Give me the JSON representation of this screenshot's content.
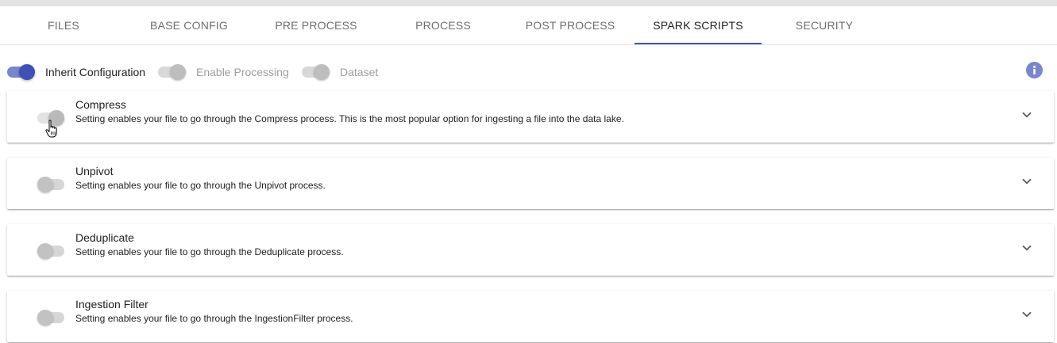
{
  "tabs": [
    {
      "label": "FILES",
      "active": false
    },
    {
      "label": "BASE CONFIG",
      "active": false
    },
    {
      "label": "PRE PROCESS",
      "active": false
    },
    {
      "label": "PROCESS",
      "active": false
    },
    {
      "label": "POST PROCESS",
      "active": false
    },
    {
      "label": "SPARK SCRIPTS",
      "active": true
    },
    {
      "label": "SECURITY",
      "active": false
    }
  ],
  "toggles": [
    {
      "label": "Inherit Configuration",
      "on": true,
      "disabled": false
    },
    {
      "label": "Enable Processing",
      "on": true,
      "disabled": true
    },
    {
      "label": "Dataset",
      "on": true,
      "disabled": true
    }
  ],
  "panels": [
    {
      "title": "Compress",
      "description": "Setting enables your file to go through the Compress process. This is the most popular option for ingesting a file into the data lake.",
      "enabled": false
    },
    {
      "title": "Unpivot",
      "description": "Setting enables your file to go through the Unpivot process.",
      "enabled": false
    },
    {
      "title": "Deduplicate",
      "description": "Setting enables your file to go through the Deduplicate process.",
      "enabled": false
    },
    {
      "title": "Ingestion Filter",
      "description": "Setting enables your file to go through the IngestionFilter process.",
      "enabled": false
    }
  ],
  "icons": {
    "info": "info-icon",
    "expand": "chevron-down-icon",
    "cursor": "hand-pointer-icon"
  },
  "colors": {
    "accent": "#3f51b5",
    "accent_light": "#7986cb",
    "info": "#7986cb",
    "disabled_text": "#9e9e9e"
  }
}
